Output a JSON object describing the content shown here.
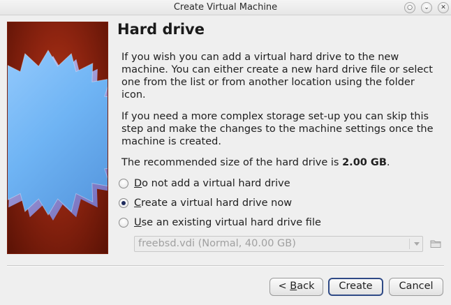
{
  "window": {
    "title": "Create Virtual Machine",
    "controls": [
      "help",
      "minimize",
      "close"
    ]
  },
  "page": {
    "heading": "Hard drive",
    "para1": "If you wish you can add a virtual hard drive to the new machine. You can either create a new hard drive file or select one from the list or from another location using the folder icon.",
    "para2": "If you need a more complex storage set-up you can skip this step and make the changes to the machine settings once the machine is created.",
    "para3_prefix": "The recommended size of the hard drive is ",
    "para3_size": "2.00 GB",
    "para3_suffix": "."
  },
  "options": [
    {
      "mnemonic": "D",
      "rest": "o not add a virtual hard drive",
      "checked": false
    },
    {
      "mnemonic": "C",
      "rest": "reate a virtual hard drive now",
      "checked": true
    },
    {
      "mnemonic": "U",
      "rest": "se an existing virtual hard drive file",
      "checked": false
    }
  ],
  "existing_drive": {
    "selected": "freebsd.vdi (Normal, 40.00 GB)",
    "enabled": false,
    "folder_icon": "folder-icon"
  },
  "buttons": {
    "back_prefix": "< ",
    "back_mnemonic": "B",
    "back_rest": "ack",
    "create": "Create",
    "cancel": "Cancel"
  },
  "colors": {
    "image_bg": "#8e2410",
    "default_button_border": "#2f4a86"
  }
}
